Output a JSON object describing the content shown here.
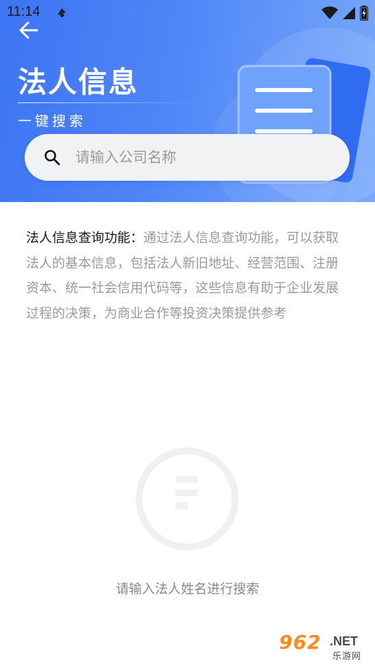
{
  "status_bar": {
    "time": "11:14"
  },
  "header": {
    "title": "法人信息",
    "subtitle": "一键搜索",
    "colors": {
      "gradient_start": "#3d74f3",
      "gradient_end": "#7aa9fb"
    }
  },
  "search": {
    "placeholder": "请输入公司名称",
    "value": ""
  },
  "description": {
    "label": "法人信息查询功能：",
    "text": "通过法人信息查询功能，可以获取法人的基本信息，包括法人新旧地址、经营范围、注册资本、统一社会信用代码等，这些信息有助于企业发展过程的决策，为商业合作等投资决策提供参考"
  },
  "empty_state": {
    "message": "请输入法人姓名进行搜索"
  },
  "watermark": {
    "number": "962",
    "suffix": ".NET",
    "chinese": "乐游网"
  },
  "icons": {
    "back": "arrow-left-icon",
    "search": "search-icon",
    "wifi": "wifi-icon",
    "signal": "signal-icon",
    "battery": "battery-icon",
    "empty": "empty-document-icon"
  }
}
